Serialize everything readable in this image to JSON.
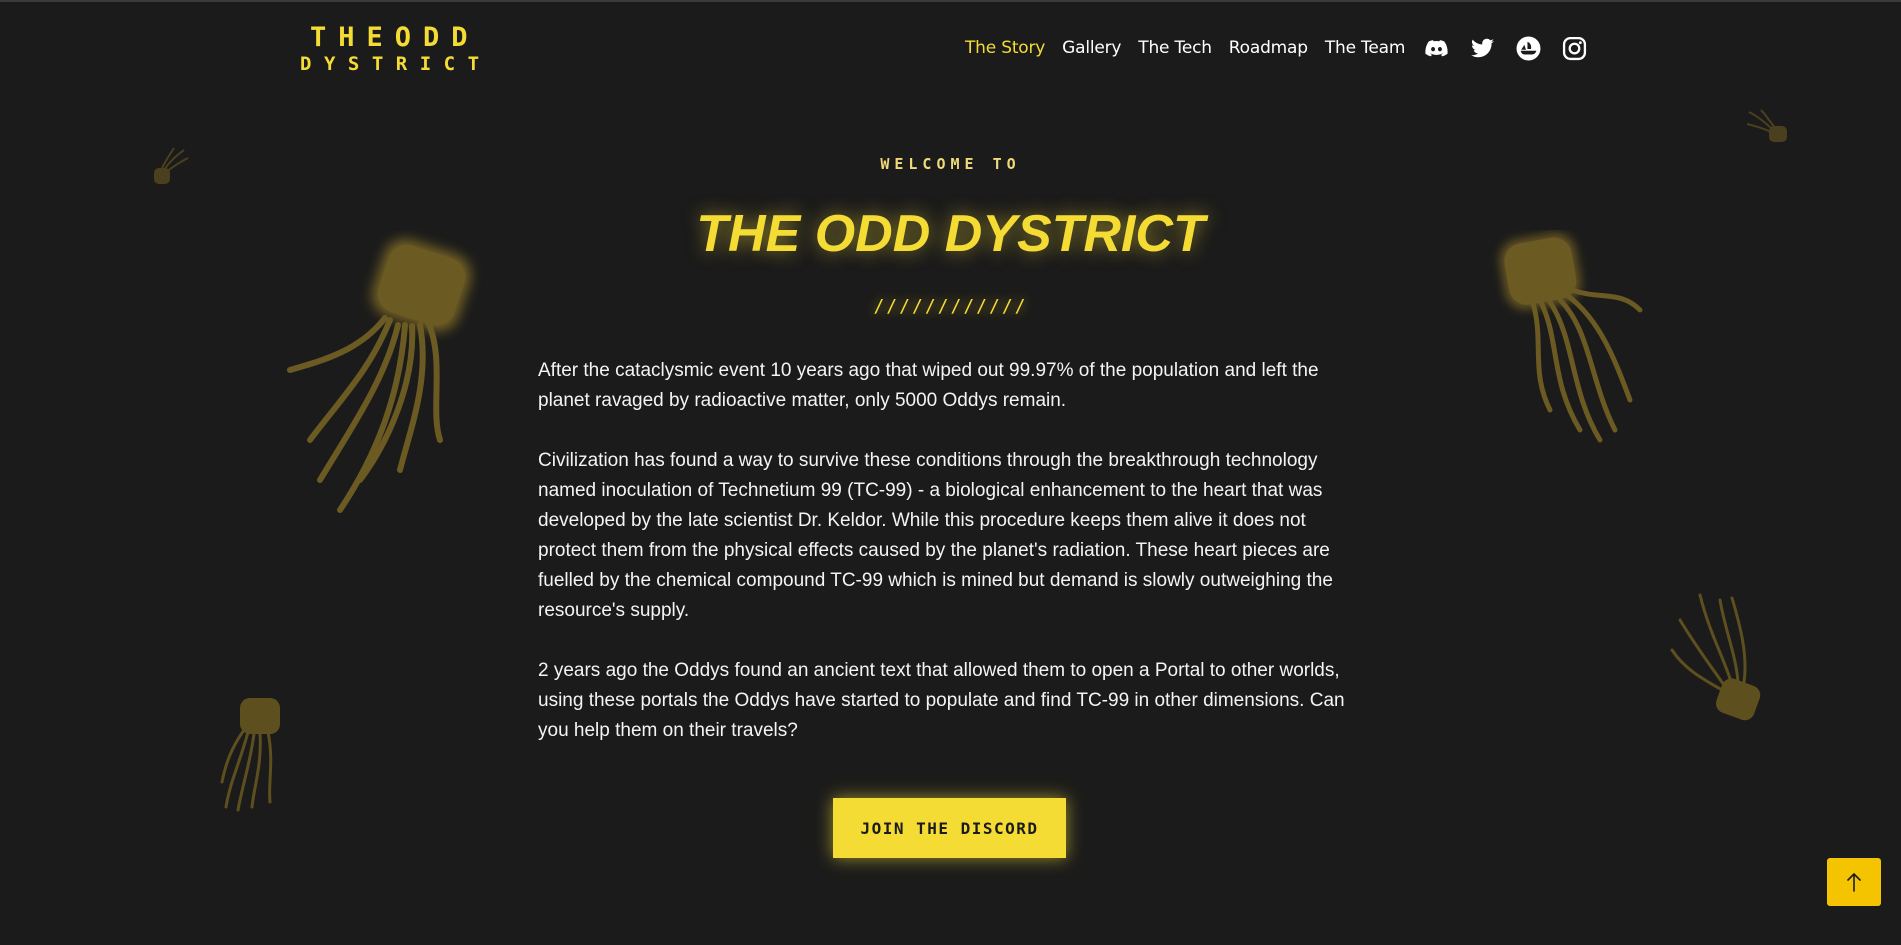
{
  "header": {
    "logo_line1": "THEODD",
    "logo_line2": "DYSTRICT",
    "nav": [
      {
        "label": "The Story",
        "active": true
      },
      {
        "label": "Gallery",
        "active": false
      },
      {
        "label": "The Tech",
        "active": false
      },
      {
        "label": "Roadmap",
        "active": false
      },
      {
        "label": "The Team",
        "active": false
      }
    ],
    "socials": [
      "discord-icon",
      "twitter-icon",
      "opensea-icon",
      "instagram-icon"
    ]
  },
  "hero": {
    "welcome": "WELCOME TO",
    "title": "THE ODD DYSTRICT",
    "divider": "////////////",
    "paragraphs": [
      "After the cataclysmic event 10 years ago that wiped out 99.97% of the population and left the planet ravaged by radioactive matter, only 5000 Oddys remain.",
      "Civilization has found a way to survive these conditions through the breakthrough technology named inoculation of Technetium 99 (TC-99) - a biological enhancement to the heart that was developed by the late scientist Dr. Keldor. While this procedure keeps them alive it does not protect them from the physical effects caused by the planet's radiation. These heart pieces are fuelled by the chemical compound TC-99 which is mined but demand is slowly outweighing the resource's supply.",
      "2 years ago the Oddys found an ancient text that allowed them to open a Portal to other worlds, using these portals the Oddys have started to populate and find TC-99 in other dimensions. Can you help them on their travels?"
    ],
    "cta_label": "JOIN THE DISCORD"
  },
  "scroll_top_icon": "arrow-up-icon",
  "colors": {
    "background": "#1b1b1b",
    "accent": "#f5dc34",
    "scroll_button": "#f5c400",
    "jellyfish": "#6b5a22"
  }
}
